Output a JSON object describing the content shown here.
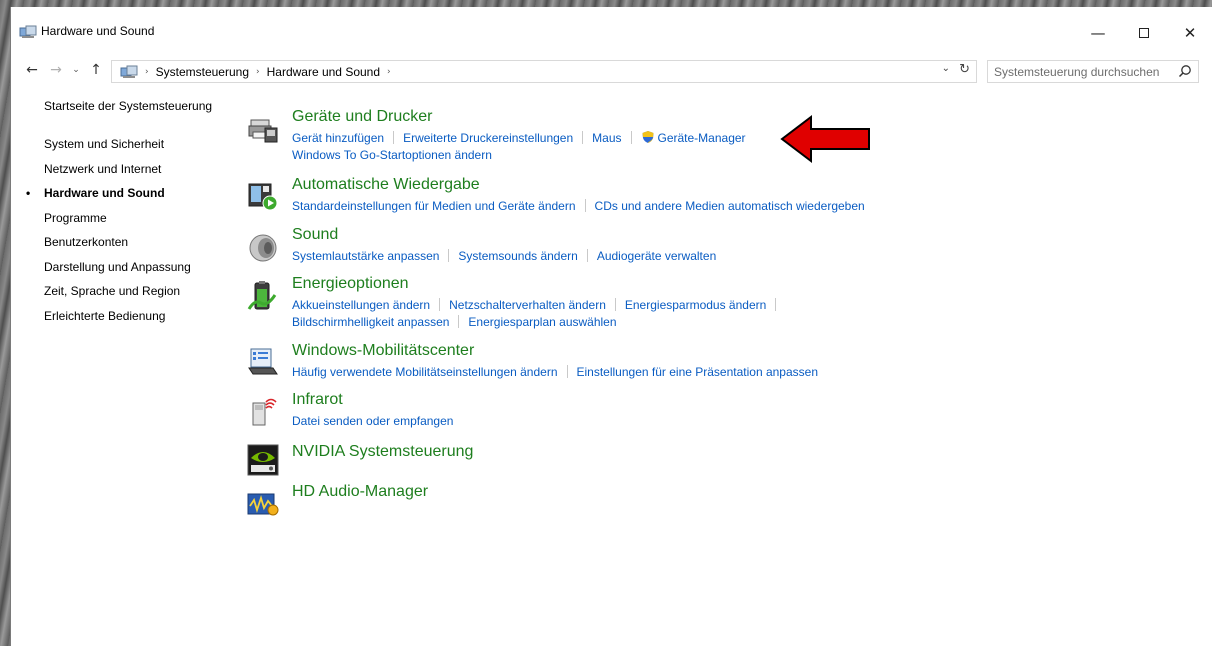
{
  "window": {
    "title": "Hardware und Sound",
    "minimize_label": "—",
    "close_label": "✕"
  },
  "nav": {
    "back": "←",
    "forward": "→",
    "recent": "⌄",
    "up": "↑",
    "breadcrumb": [
      "Systemsteuerung",
      "Hardware und Sound"
    ],
    "crumb_sep": "›",
    "dropdown": "⌄",
    "refresh": "↻"
  },
  "search": {
    "placeholder": "Systemsteuerung durchsuchen"
  },
  "sidebar": {
    "bullet": "•",
    "items": [
      {
        "label": "Startseite der Systemsteuerung",
        "active": false
      },
      {
        "label": "System und Sicherheit",
        "active": false
      },
      {
        "label": "Netzwerk und Internet",
        "active": false
      },
      {
        "label": "Hardware und Sound",
        "active": true
      },
      {
        "label": "Programme",
        "active": false
      },
      {
        "label": "Benutzerkonten",
        "active": false
      },
      {
        "label": "Darstellung und Anpassung",
        "active": false
      },
      {
        "label": "Zeit, Sprache und Region",
        "active": false
      },
      {
        "label": "Erleichterte Bedienung",
        "active": false
      }
    ]
  },
  "categories": [
    {
      "title": "Geräte und Drucker",
      "icon": "printer-icon",
      "links_line1": [
        "Gerät hinzufügen",
        "Erweiterte Druckereinstellungen",
        "Maus",
        "Geräte-Manager"
      ],
      "links_line2": [
        "Windows To Go-Startoptionen ändern"
      ]
    },
    {
      "title": "Automatische Wiedergabe",
      "icon": "autoplay-icon",
      "links_line1": [
        "Standardeinstellungen für Medien und Geräte ändern",
        "CDs und andere Medien automatisch wiedergeben"
      ]
    },
    {
      "title": "Sound",
      "icon": "speaker-icon",
      "links_line1": [
        "Systemlautstärke anpassen",
        "Systemsounds ändern",
        "Audiogeräte verwalten"
      ]
    },
    {
      "title": "Energieoptionen",
      "icon": "battery-icon",
      "links_line1": [
        "Akkueinstellungen ändern",
        "Netzschalterverhalten ändern",
        "Energiesparmodus ändern"
      ],
      "links_line2": [
        "Bildschirmhelligkeit anpassen",
        "Energiesparplan auswählen"
      ]
    },
    {
      "title": "Windows-Mobilitätscenter",
      "icon": "mobility-center-icon",
      "links_line1": [
        "Häufig verwendete Mobilitätseinstellungen ändern",
        "Einstellungen für eine Präsentation anpassen"
      ]
    },
    {
      "title": "Infrarot",
      "icon": "infrared-icon",
      "links_line1": [
        "Datei senden oder empfangen"
      ]
    },
    {
      "title": "NVIDIA Systemsteuerung",
      "icon": "nvidia-icon"
    },
    {
      "title": "HD Audio-Manager",
      "icon": "hd-audio-icon"
    }
  ],
  "colors": {
    "category_title": "#1e7e1e",
    "link": "#0a5cc2",
    "annotation_arrow": "#e00000"
  }
}
